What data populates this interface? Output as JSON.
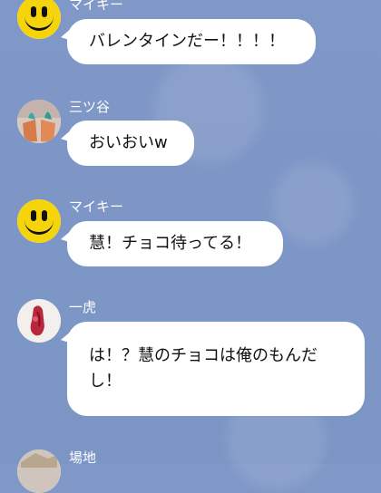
{
  "chat": {
    "messages": [
      {
        "sender": "マイキー",
        "text": "バレンタインだー！！！！",
        "avatar": "smiley-icon"
      },
      {
        "sender": "三ツ谷",
        "text": "おいおいw",
        "avatar": "photo-avatar"
      },
      {
        "sender": "マイキー",
        "text": "慧！チョコ待ってる！",
        "avatar": "smiley-icon"
      },
      {
        "sender": "一虎",
        "text": "は！？慧のチョコは俺のもんだ\nし！",
        "avatar": "photo-avatar"
      },
      {
        "sender": "場地",
        "text": "",
        "avatar": "photo-avatar"
      }
    ]
  },
  "colors": {
    "background": "#7d96c6",
    "bubble": "#ffffff",
    "sender_name": "#ffffff",
    "smiley": "#f6d40b"
  }
}
